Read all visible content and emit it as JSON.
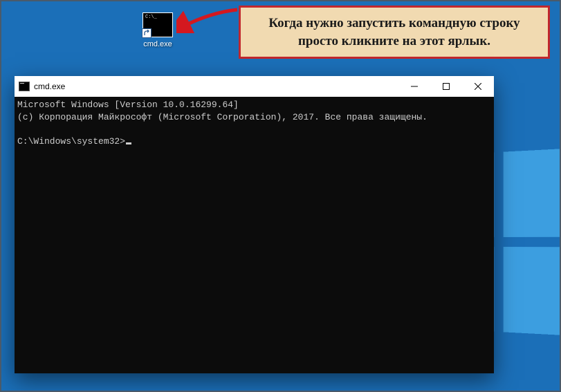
{
  "desktop": {
    "icon_label": "cmd.exe"
  },
  "tooltip": {
    "text": "Когда нужно запустить командную строку просто кликните на этот ярлык."
  },
  "console": {
    "title": "cmd.exe",
    "line1": "Microsoft Windows [Version 10.0.16299.64]",
    "line2": "(c) Корпорация Майкрософт (Microsoft Corporation), 2017. Все права защищены.",
    "blank": "",
    "prompt": "C:\\Windows\\system32>"
  }
}
